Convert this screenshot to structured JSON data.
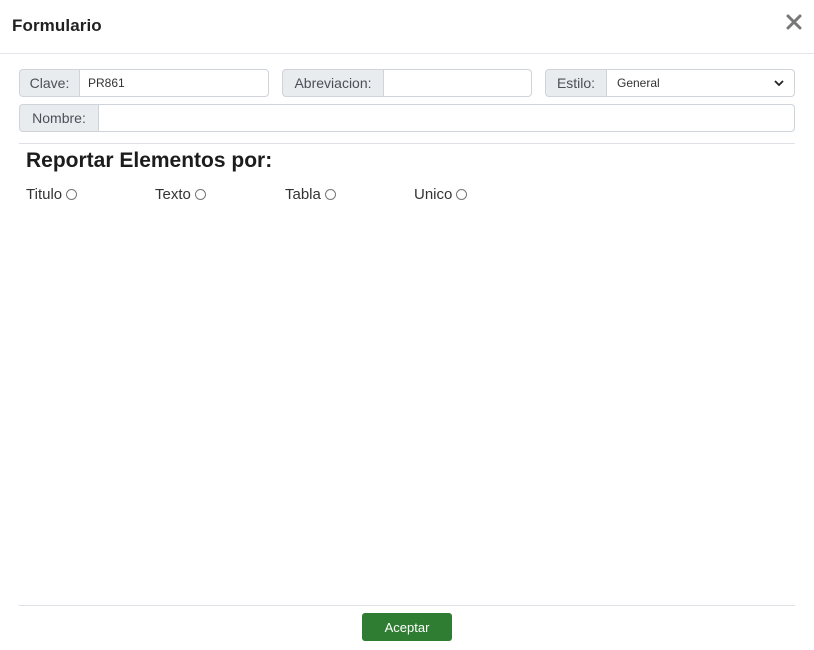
{
  "modal": {
    "title": "Formulario",
    "close_icon": "close-icon"
  },
  "fields": {
    "clave": {
      "label": "Clave:",
      "value": "PR861"
    },
    "abreviacion": {
      "label": "Abreviacion:",
      "value": ""
    },
    "estilo": {
      "label": "Estilo:",
      "selected": "General"
    },
    "nombre": {
      "label": "Nombre:",
      "value": ""
    }
  },
  "report": {
    "title": "Reportar Elementos por:",
    "options": [
      {
        "label": "Titulo",
        "checked": false
      },
      {
        "label": "Texto",
        "checked": false
      },
      {
        "label": "Tabla",
        "checked": false
      },
      {
        "label": "Unico",
        "checked": false
      }
    ]
  },
  "footer": {
    "accept_label": "Aceptar"
  },
  "colors": {
    "accept_button": "#2e7d32",
    "addon_bg": "#e9ecef",
    "border": "#ced4da"
  }
}
